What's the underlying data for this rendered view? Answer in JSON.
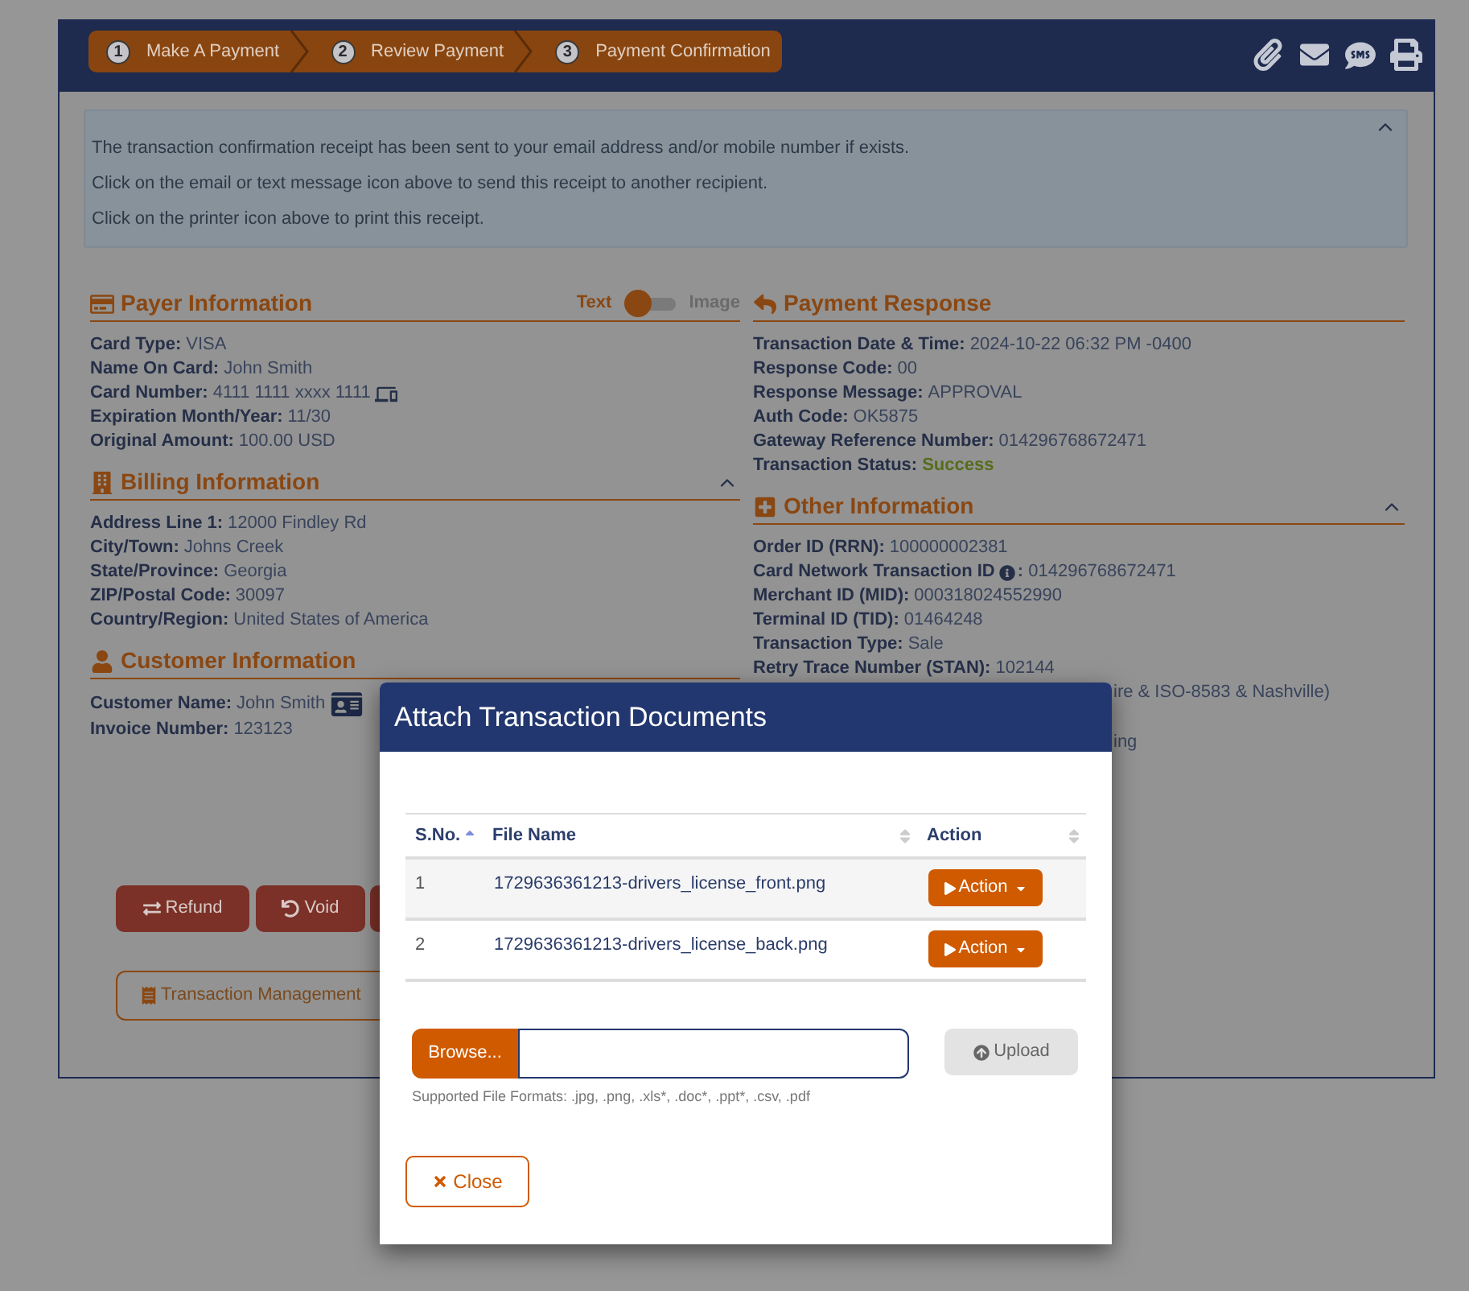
{
  "steps": [
    {
      "number": "1",
      "label": "Make A Payment"
    },
    {
      "number": "2",
      "label": "Review Payment"
    },
    {
      "number": "3",
      "label": "Payment Confirmation"
    }
  ],
  "notice": {
    "expanded": true,
    "lines": [
      "The transaction confirmation receipt has been sent to your email address and/or mobile number if exists.",
      "Click on the email or text message icon above to send this receipt to another recipient.",
      "Click on the printer icon above to print this receipt."
    ]
  },
  "left_sections": [
    {
      "title": "Payer Information",
      "toggle": {
        "options": [
          {
            "label": "Text",
            "selected": true
          },
          {
            "label": "Image",
            "selected": false
          }
        ]
      },
      "fields": [
        {
          "kind": "text",
          "label": "Card Type:",
          "value": "VISA"
        },
        {
          "kind": "text",
          "label": "Name On Card:",
          "value": "John Smith"
        },
        {
          "kind": "device",
          "label": "Card Number:",
          "value": "4111 1111 xxxx 1111"
        },
        {
          "kind": "text",
          "label": "Expiration Month/Year:",
          "value": "11/30"
        },
        {
          "kind": "text",
          "label": "Original Amount:",
          "value": "100.00 USD"
        }
      ]
    },
    {
      "title": "Billing Information",
      "expanded": true,
      "fields": [
        {
          "kind": "text",
          "label": "Address Line 1:",
          "value": "12000 Findley Rd"
        },
        {
          "kind": "text",
          "label": "City/Town:",
          "value": "Johns Creek"
        },
        {
          "kind": "text",
          "label": "State/Province:",
          "value": "Georgia"
        },
        {
          "kind": "text",
          "label": "ZIP/Postal Code:",
          "value": "30097"
        },
        {
          "kind": "text",
          "label": "Country/Region:",
          "value": "United States of America"
        }
      ]
    },
    {
      "title": "Customer Information",
      "fields": [
        {
          "kind": "contact",
          "label": "Customer Name:",
          "value": "John Smith"
        },
        {
          "kind": "text",
          "label": "Invoice Number:",
          "value": "123123"
        }
      ]
    }
  ],
  "right_sections": [
    {
      "title": "Payment Response",
      "fields": [
        {
          "kind": "text",
          "label": "Transaction Date & Time:",
          "value": "2024-10-22 06:32 PM -0400"
        },
        {
          "kind": "text",
          "label": "Response Code:",
          "value": "00"
        },
        {
          "kind": "text",
          "label": "Response Message:",
          "value": "APPROVAL"
        },
        {
          "kind": "text",
          "label": "Auth Code:",
          "value": "OK5875"
        },
        {
          "kind": "text",
          "label": "Gateway Reference Number:",
          "value": "014296768672471"
        },
        {
          "kind": "status",
          "label": "Transaction Status:",
          "value": "Success"
        }
      ]
    },
    {
      "title": "Other Information",
      "expanded": true,
      "fields": [
        {
          "kind": "text",
          "label": "Order ID (RRN):",
          "value": "100000002381"
        },
        {
          "kind": "info",
          "label": "Card Network Transaction ID",
          "value": "**:** 014296768672471"
        },
        {
          "kind": "text",
          "label": "Merchant ID (MID):",
          "value": "000318024552990"
        },
        {
          "kind": "text",
          "label": "Terminal ID (TID):",
          "value": "01464248"
        },
        {
          "kind": "text",
          "label": "Transaction Type:",
          "value": "Sale"
        },
        {
          "kind": "text",
          "label": "Retry Trace Number (STAN):",
          "value": "102144"
        }
      ],
      "covered_lines": [
        "ire & ISO-8583 & Nashville)",
        "ing"
      ]
    }
  ],
  "transaction_buttons": [
    {
      "label": "Refund"
    },
    {
      "label": "Void"
    }
  ],
  "management_button": {
    "label": "Transaction Management"
  },
  "dialog": {
    "title": "Attach Transaction Documents",
    "columns": [
      {
        "label": "S.No.",
        "sorted": true
      },
      {
        "label": "File Name",
        "sorted": false
      },
      {
        "label": "Action",
        "sorted": false
      }
    ],
    "rows": [
      {
        "number": "1",
        "file_name": "1729636361213-drivers_license_front.png",
        "action": "Action"
      },
      {
        "number": "2",
        "file_name": "1729636361213-drivers_license_back.png",
        "action": "Action"
      }
    ],
    "browse_button": "Browse...",
    "upload_button": {
      "label": "Upload",
      "disabled": true
    },
    "formats_note": "Supported File Formats: .jpg, .png, .xls*, .doc*, .ppt*, .csv, .pdf",
    "close_button": "Close"
  }
}
